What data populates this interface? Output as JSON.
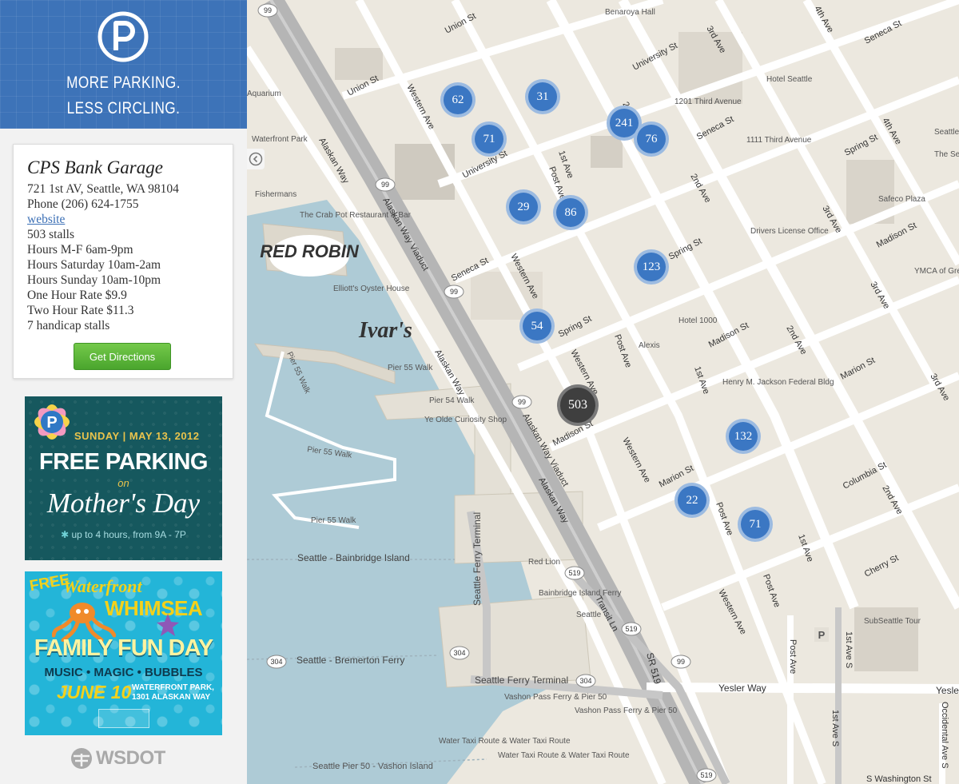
{
  "logo": {
    "icon": "parking-p-icon",
    "line1": "MORE PARKING.",
    "line2": "LESS CIRCLING."
  },
  "garage": {
    "name": "CPS Bank Garage",
    "address": "721 1st AV, Seattle, WA 98104",
    "phone": "Phone (206) 624-1755",
    "website": "website",
    "stalls": "503 stalls",
    "hours_mf": "Hours M-F 6am-9pm",
    "hours_sat": "Hours Saturday 10am-2am",
    "hours_sun": "Hours Sunday 10am-10pm",
    "one_hour": "One Hour Rate $9.9",
    "two_hour": "Two Hour Rate $11.3",
    "handicap": "7 handicap stalls",
    "directions": "Get Directions"
  },
  "ads": {
    "mothers_day": {
      "date": "SUNDAY | MAY 13, 2012",
      "headline": "FREE PARKING",
      "on": "on",
      "title": "Mother's Day",
      "note": "up to 4 hours, from 9A - 7P"
    },
    "waterfront": {
      "free": "FREE",
      "title1": "Waterfront",
      "title2": "WHIMSEA",
      "event": "FAMILY FUN DAY",
      "sub": "MUSIC • MAGIC • BUBBLES",
      "date": "JUNE 10",
      "place1": "WATERFRONT PARK,",
      "place2": "1301 ALASKAN WAY"
    }
  },
  "footer": {
    "logo_text": "WSDOT"
  },
  "markers": [
    {
      "label": "62",
      "selected": false
    },
    {
      "label": "31",
      "selected": false
    },
    {
      "label": "71",
      "selected": false
    },
    {
      "label": "241",
      "selected": false
    },
    {
      "label": "76",
      "selected": false
    },
    {
      "label": "29",
      "selected": false
    },
    {
      "label": "86",
      "selected": false
    },
    {
      "label": "123",
      "selected": false
    },
    {
      "label": "54",
      "selected": false
    },
    {
      "label": "503",
      "selected": true
    },
    {
      "label": "132",
      "selected": false
    },
    {
      "label": "22",
      "selected": false
    },
    {
      "label": "71",
      "selected": false
    }
  ],
  "street_labels": [
    "Alaskan Way",
    "Alaskan Way Viaduct",
    "Western Ave",
    "1st Ave",
    "2nd Ave",
    "3rd Ave",
    "4th Ave",
    "Post Ave",
    "Union St",
    "University St",
    "Seneca St",
    "Spring St",
    "Madison St",
    "Marion St",
    "Columbia St",
    "Cherry St",
    "Yesler Way",
    "SR 519",
    "Transit Ln",
    "Occidental Ave S",
    "1st Ave S",
    "S Washington St"
  ],
  "place_labels": [
    "Benaroya Hall",
    "1201 Third Avenue",
    "1111 Third Avenue",
    "Hotel Seattle",
    "Safeco Plaza",
    "Drivers License Office",
    "YMCA of Greater Seattle",
    "Hotel 1000",
    "Alexis",
    "Henry M. Jackson Federal Bldg",
    "Waterfront Park",
    "Fishermans",
    "The Crab Pot Restaurant & Bar",
    "Elliott's Oyster House",
    "Pier 55 Walk",
    "Pier 54 Walk",
    "Ye Olde Curiosity Shop",
    "Seattle - Bainbridge Island",
    "Seattle - Bremerton Ferry",
    "Seattle Ferry Terminal",
    "Red Lion",
    "Bainbridge Island Ferry",
    "Seattle",
    "Vashon Pass Ferry & Pier 50",
    "Water Taxi Route & Water Taxi Route",
    "Seattle Pier 50 - Vashon Island",
    "SubSeattle Tour",
    "Aquarium",
    "Seattle Central Library",
    "The Seattle Public Library"
  ],
  "map_colors": {
    "land": "#ece8df",
    "water": "#aecbd6",
    "road": "#ffffff",
    "highway": "#b5b5b5",
    "marker": "#3b77c3",
    "selected_marker": "#3f3f3f"
  }
}
